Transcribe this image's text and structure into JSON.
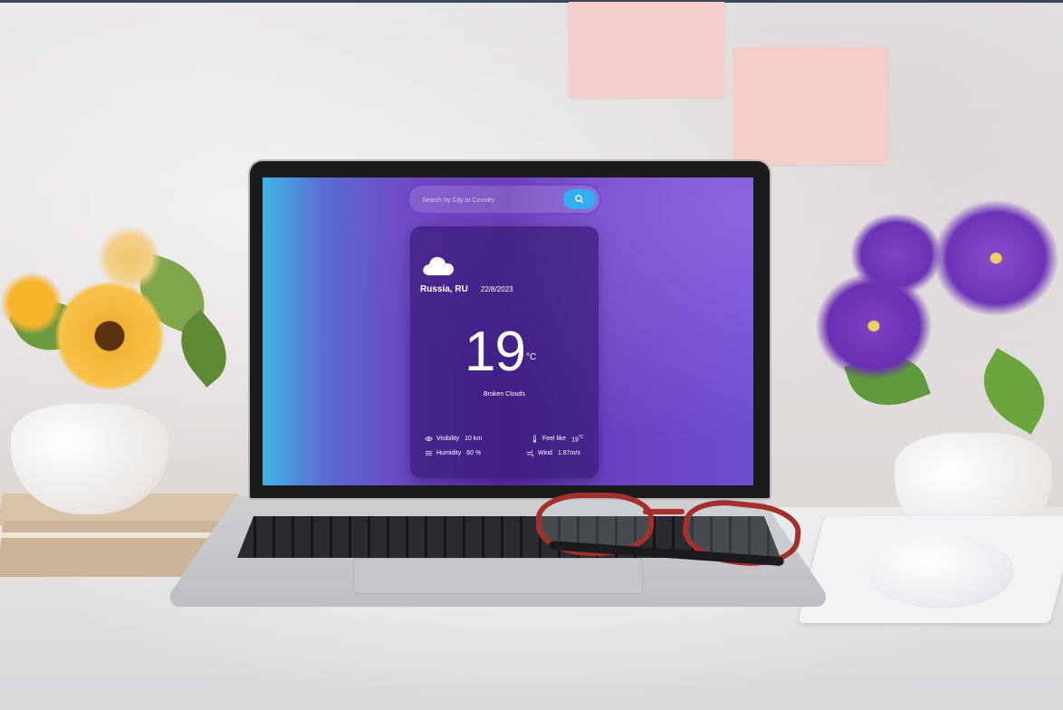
{
  "search": {
    "placeholder": "Search by City or Country"
  },
  "weather": {
    "location": "Russia, RU",
    "date": "22/8/2023",
    "temperature": "19",
    "unit": "°C",
    "description": "Broken Clouds",
    "icon": "cloud-icon"
  },
  "stats": {
    "visibility": {
      "label": "Visibility",
      "value": "10 km",
      "icon": "eye-icon"
    },
    "feels_like": {
      "label": "Feel like",
      "value": "19",
      "unit": "°C",
      "icon": "thermometer-icon"
    },
    "humidity": {
      "label": "Humidity",
      "value": "60 %",
      "icon": "humidity-icon"
    },
    "wind": {
      "label": "Wind",
      "value": "1.87m/s",
      "icon": "wind-icon"
    }
  },
  "colors": {
    "search_button": "#33aef0",
    "card_background": "#371c78",
    "background_accent": "#6b3fbe"
  }
}
